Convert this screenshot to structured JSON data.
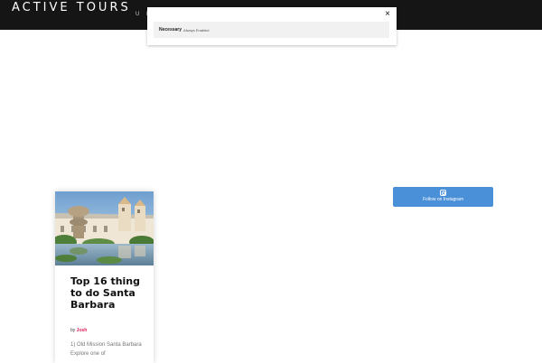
{
  "header": {
    "logo_text": "ACTIVE TOURS",
    "nav_fragment": "U N"
  },
  "cookie_modal": {
    "close_symbol": "×",
    "category": {
      "name": "Necessary",
      "state": "Always Enabled"
    }
  },
  "instagram": {
    "icon": "instagram-icon",
    "label": "Follow on Instagram",
    "color": "#4a90d9"
  },
  "card": {
    "image_icon": "mission-photo",
    "title": "Top 16 thing to do Santa Barbara",
    "byline_prefix": "by",
    "author": "Josh",
    "author_color": "#e0245e",
    "excerpt": "1) Old Mission Santa Barbara Explore one of"
  }
}
